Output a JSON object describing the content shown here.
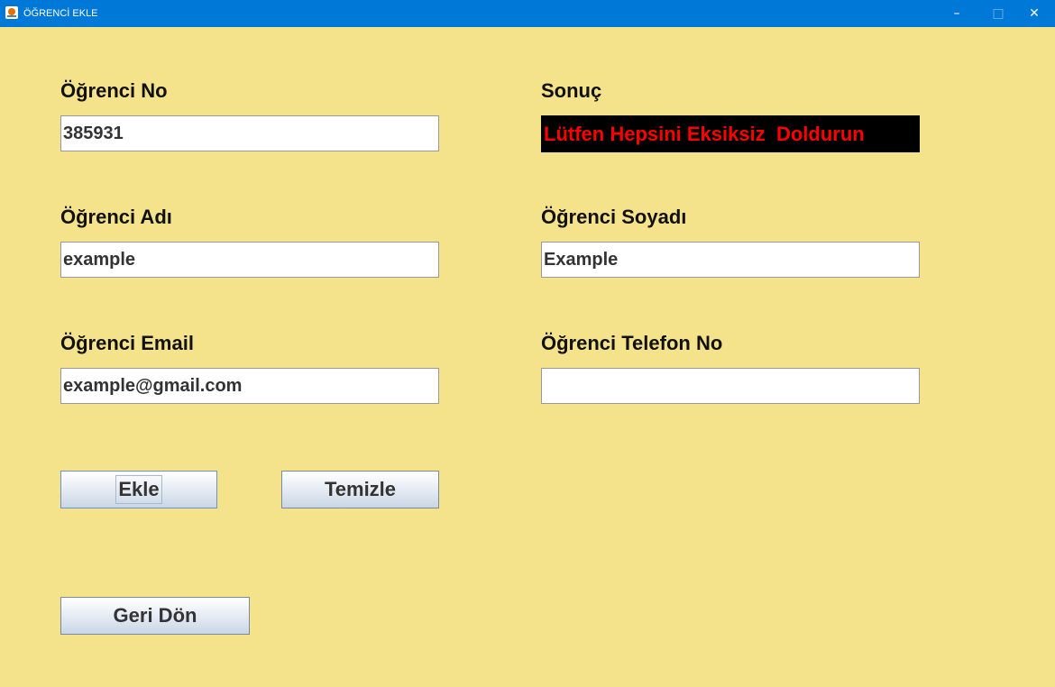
{
  "window": {
    "title": "ÖĞRENCİ EKLE",
    "controls": {
      "minimize": "–",
      "maximize": "□",
      "close": "✕"
    }
  },
  "form": {
    "student_no": {
      "label": "Öğrenci No",
      "value": "385931"
    },
    "first_name": {
      "label": "Öğrenci Adı",
      "value": "example"
    },
    "last_name": {
      "label": "Öğrenci Soyadı",
      "value": "Example"
    },
    "email": {
      "label": "Öğrenci Email",
      "value": "example@gmail.com"
    },
    "phone": {
      "label": "Öğrenci Telefon No",
      "value": ""
    }
  },
  "result": {
    "label": "Sonuç",
    "message": "Lütfen Hepsini Eksiksiz  Doldurun",
    "text_color": "#ff0000",
    "background": "#000000"
  },
  "buttons": {
    "add": "Ekle",
    "clear": "Temizle",
    "back": "Geri Dön"
  },
  "colors": {
    "background": "#f5e38c",
    "titlebar": "#0078d7"
  }
}
